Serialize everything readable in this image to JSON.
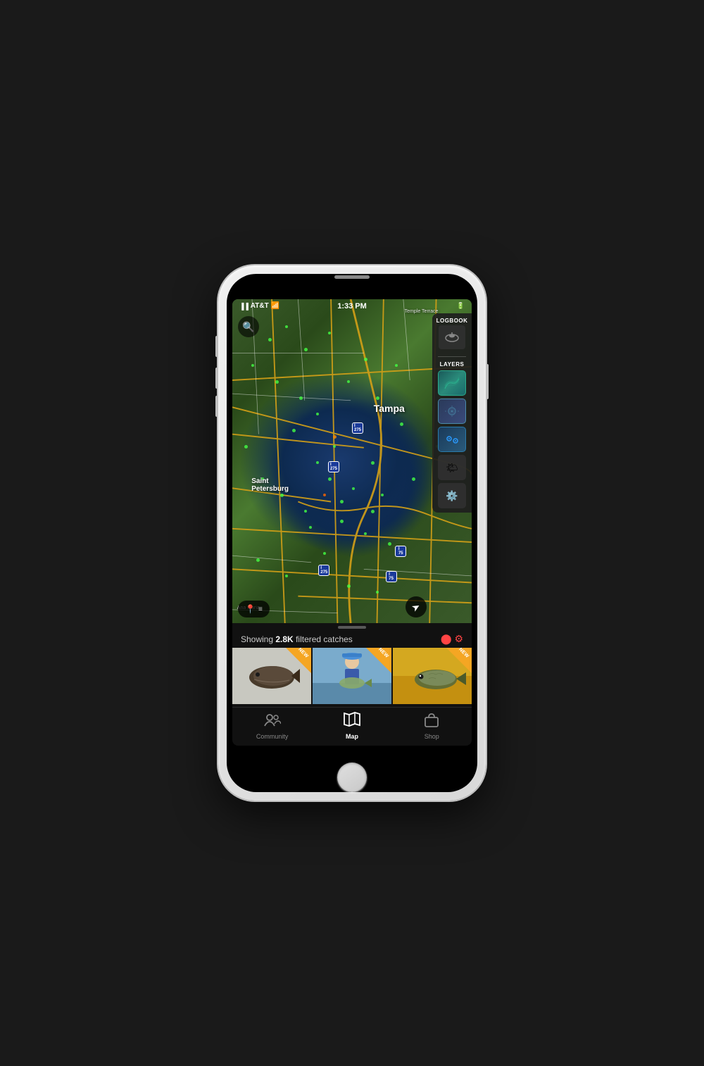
{
  "phone": {
    "status_bar": {
      "carrier": "AT&T",
      "time": "1:33 PM",
      "battery": "1",
      "wifi": true
    }
  },
  "map": {
    "location": "Tampa Bay Area, FL",
    "labels": {
      "tampa": "Tampa",
      "saint_petersburg": "Saint\nPetersburg",
      "temple_terrace": "Temple Terrace",
      "anna_maria": "Ana Maria"
    },
    "interstates": [
      "275",
      "275",
      "275",
      "75",
      "75"
    ]
  },
  "right_panel": {
    "logbook_label": "LOGBOOK",
    "layers_label": "LAYERS",
    "layers": [
      {
        "name": "topo",
        "icon": "🗺"
      },
      {
        "name": "weather",
        "icon": "🌀"
      },
      {
        "name": "waypoints",
        "icon": "📍"
      }
    ],
    "weather_label": "weather",
    "settings_label": "settings"
  },
  "bottom_sheet": {
    "drag_handle": true,
    "filter_text": "Showing ",
    "catch_count": "2.8K",
    "filter_suffix": " filtered catches",
    "catches": [
      {
        "id": 1,
        "badge": "NEW"
      },
      {
        "id": 2,
        "badge": "NEW"
      },
      {
        "id": 3,
        "badge": "NEW"
      }
    ]
  },
  "nav": {
    "items": [
      {
        "id": "community",
        "label": "Community",
        "icon": "👥",
        "active": false
      },
      {
        "id": "map",
        "label": "Map",
        "icon": "🗺",
        "active": true
      },
      {
        "id": "shop",
        "label": "Shop",
        "icon": "🛍",
        "active": false
      }
    ]
  },
  "map_controls": {
    "search_icon": "🔍",
    "legend_icon": "📍",
    "compass_icon": "➤"
  },
  "badges": {
    "new_label": "NEW"
  }
}
